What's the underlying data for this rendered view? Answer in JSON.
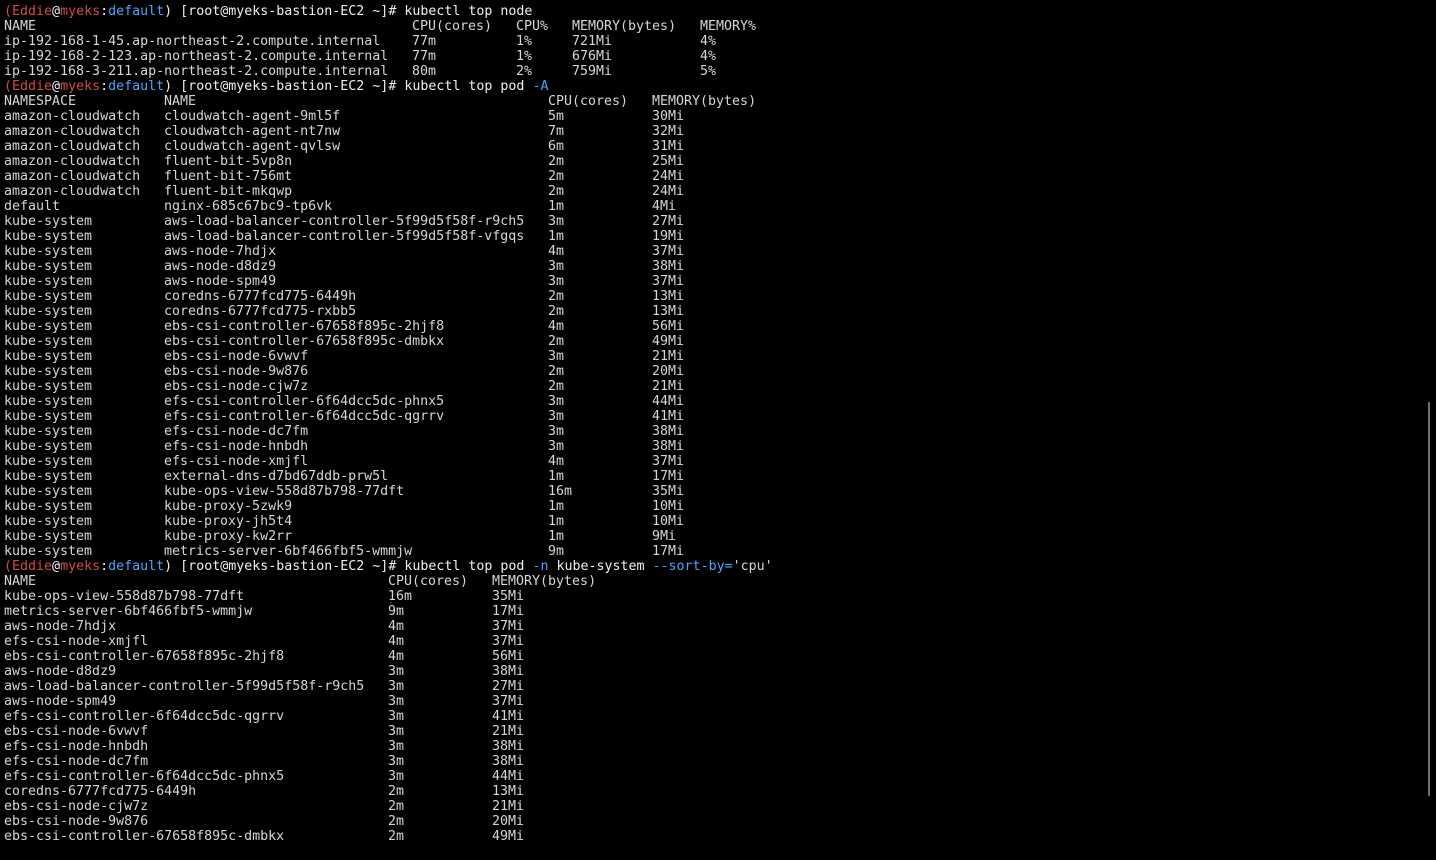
{
  "prompt": {
    "user": "Eddie",
    "at": "@",
    "host": "myeks",
    "colon": ":",
    "context": "default",
    "close": ")",
    "open": "(",
    "rest": " [root@myeks-bastion-EC2 ~]# "
  },
  "cmd1": "kubectl top node",
  "node_header": [
    "NAME",
    "CPU(cores)",
    "CPU%",
    "MEMORY(bytes)",
    "MEMORY%"
  ],
  "nodes": [
    [
      "ip-192-168-1-45.ap-northeast-2.compute.internal",
      "77m",
      "1%",
      "721Mi",
      "4%"
    ],
    [
      "ip-192-168-2-123.ap-northeast-2.compute.internal",
      "77m",
      "1%",
      "676Mi",
      "4%"
    ],
    [
      "ip-192-168-3-211.ap-northeast-2.compute.internal",
      "80m",
      "2%",
      "759Mi",
      "5%"
    ]
  ],
  "cmd2": {
    "text": "kubectl top pod ",
    "flag": "-A"
  },
  "pod_header": [
    "NAMESPACE",
    "NAME",
    "CPU(cores)",
    "MEMORY(bytes)"
  ],
  "pods": [
    [
      "amazon-cloudwatch",
      "cloudwatch-agent-9ml5f",
      "5m",
      "30Mi"
    ],
    [
      "amazon-cloudwatch",
      "cloudwatch-agent-nt7nw",
      "7m",
      "32Mi"
    ],
    [
      "amazon-cloudwatch",
      "cloudwatch-agent-qvlsw",
      "6m",
      "31Mi"
    ],
    [
      "amazon-cloudwatch",
      "fluent-bit-5vp8n",
      "2m",
      "25Mi"
    ],
    [
      "amazon-cloudwatch",
      "fluent-bit-756mt",
      "2m",
      "24Mi"
    ],
    [
      "amazon-cloudwatch",
      "fluent-bit-mkqwp",
      "2m",
      "24Mi"
    ],
    [
      "default",
      "nginx-685c67bc9-tp6vk",
      "1m",
      "4Mi"
    ],
    [
      "kube-system",
      "aws-load-balancer-controller-5f99d5f58f-r9ch5",
      "3m",
      "27Mi"
    ],
    [
      "kube-system",
      "aws-load-balancer-controller-5f99d5f58f-vfgqs",
      "1m",
      "19Mi"
    ],
    [
      "kube-system",
      "aws-node-7hdjx",
      "4m",
      "37Mi"
    ],
    [
      "kube-system",
      "aws-node-d8dz9",
      "3m",
      "38Mi"
    ],
    [
      "kube-system",
      "aws-node-spm49",
      "3m",
      "37Mi"
    ],
    [
      "kube-system",
      "coredns-6777fcd775-6449h",
      "2m",
      "13Mi"
    ],
    [
      "kube-system",
      "coredns-6777fcd775-rxbb5",
      "2m",
      "13Mi"
    ],
    [
      "kube-system",
      "ebs-csi-controller-67658f895c-2hjf8",
      "4m",
      "56Mi"
    ],
    [
      "kube-system",
      "ebs-csi-controller-67658f895c-dmbkx",
      "2m",
      "49Mi"
    ],
    [
      "kube-system",
      "ebs-csi-node-6vwvf",
      "3m",
      "21Mi"
    ],
    [
      "kube-system",
      "ebs-csi-node-9w876",
      "2m",
      "20Mi"
    ],
    [
      "kube-system",
      "ebs-csi-node-cjw7z",
      "2m",
      "21Mi"
    ],
    [
      "kube-system",
      "efs-csi-controller-6f64dcc5dc-phnx5",
      "3m",
      "44Mi"
    ],
    [
      "kube-system",
      "efs-csi-controller-6f64dcc5dc-qgrrv",
      "3m",
      "41Mi"
    ],
    [
      "kube-system",
      "efs-csi-node-dc7fm",
      "3m",
      "38Mi"
    ],
    [
      "kube-system",
      "efs-csi-node-hnbdh",
      "3m",
      "38Mi"
    ],
    [
      "kube-system",
      "efs-csi-node-xmjfl",
      "4m",
      "37Mi"
    ],
    [
      "kube-system",
      "external-dns-d7bd67ddb-prw5l",
      "1m",
      "17Mi"
    ],
    [
      "kube-system",
      "kube-ops-view-558d87b798-77dft",
      "16m",
      "35Mi"
    ],
    [
      "kube-system",
      "kube-proxy-5zwk9",
      "1m",
      "10Mi"
    ],
    [
      "kube-system",
      "kube-proxy-jh5t4",
      "1m",
      "10Mi"
    ],
    [
      "kube-system",
      "kube-proxy-kw2rr",
      "1m",
      "9Mi"
    ],
    [
      "kube-system",
      "metrics-server-6bf466fbf5-wmmjw",
      "9m",
      "17Mi"
    ]
  ],
  "cmd3": {
    "text1": "kubectl top pod ",
    "flag1": "-n",
    "text2": " kube-system ",
    "flag2": "--sort-by=",
    "arg": "'cpu'"
  },
  "sorted_header": [
    "NAME",
    "CPU(cores)",
    "MEMORY(bytes)"
  ],
  "sorted": [
    [
      "kube-ops-view-558d87b798-77dft",
      "16m",
      "35Mi"
    ],
    [
      "metrics-server-6bf466fbf5-wmmjw",
      "9m",
      "17Mi"
    ],
    [
      "aws-node-7hdjx",
      "4m",
      "37Mi"
    ],
    [
      "efs-csi-node-xmjfl",
      "4m",
      "37Mi"
    ],
    [
      "ebs-csi-controller-67658f895c-2hjf8",
      "4m",
      "56Mi"
    ],
    [
      "aws-node-d8dz9",
      "3m",
      "38Mi"
    ],
    [
      "aws-load-balancer-controller-5f99d5f58f-r9ch5",
      "3m",
      "27Mi"
    ],
    [
      "aws-node-spm49",
      "3m",
      "37Mi"
    ],
    [
      "efs-csi-controller-6f64dcc5dc-qgrrv",
      "3m",
      "41Mi"
    ],
    [
      "ebs-csi-node-6vwvf",
      "3m",
      "21Mi"
    ],
    [
      "efs-csi-node-hnbdh",
      "3m",
      "38Mi"
    ],
    [
      "efs-csi-node-dc7fm",
      "3m",
      "38Mi"
    ],
    [
      "efs-csi-controller-6f64dcc5dc-phnx5",
      "3m",
      "44Mi"
    ],
    [
      "coredns-6777fcd775-6449h",
      "2m",
      "13Mi"
    ],
    [
      "ebs-csi-node-cjw7z",
      "2m",
      "21Mi"
    ],
    [
      "ebs-csi-node-9w876",
      "2m",
      "20Mi"
    ],
    [
      "ebs-csi-controller-67658f895c-dmbkx",
      "2m",
      "49Mi"
    ]
  ]
}
